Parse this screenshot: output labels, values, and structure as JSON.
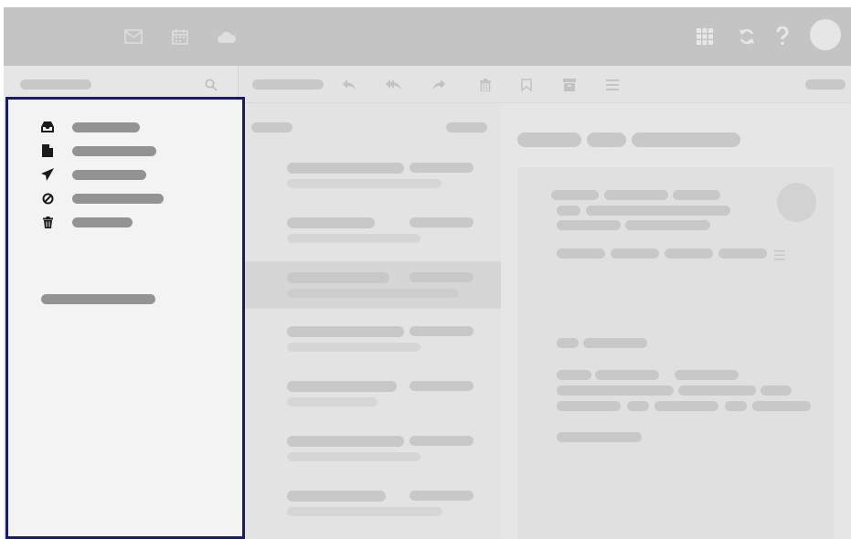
{
  "app": {
    "type": "mail-client-skeleton"
  },
  "topbar": {
    "icons": [
      "mail-icon",
      "calendar-icon",
      "cloud-icon"
    ],
    "right_icons": [
      "apps-grid-icon",
      "refresh-icon",
      "help-icon"
    ]
  },
  "toolbar": {
    "icons": [
      "reply-icon",
      "reply-all-icon",
      "forward-icon",
      "delete-icon",
      "bookmark-icon",
      "archive-icon",
      "menu-icon"
    ]
  },
  "sidebar": {
    "folders": [
      {
        "icon": "inbox-icon"
      },
      {
        "icon": "drafts-icon"
      },
      {
        "icon": "sent-icon"
      },
      {
        "icon": "spam-icon"
      },
      {
        "icon": "trash-icon"
      }
    ]
  },
  "colors": {
    "highlight_border": "#1a1a66",
    "topbar": "#c4c4c4",
    "placeholder": "#c8c8c8",
    "placeholder_dark": "#939393"
  }
}
